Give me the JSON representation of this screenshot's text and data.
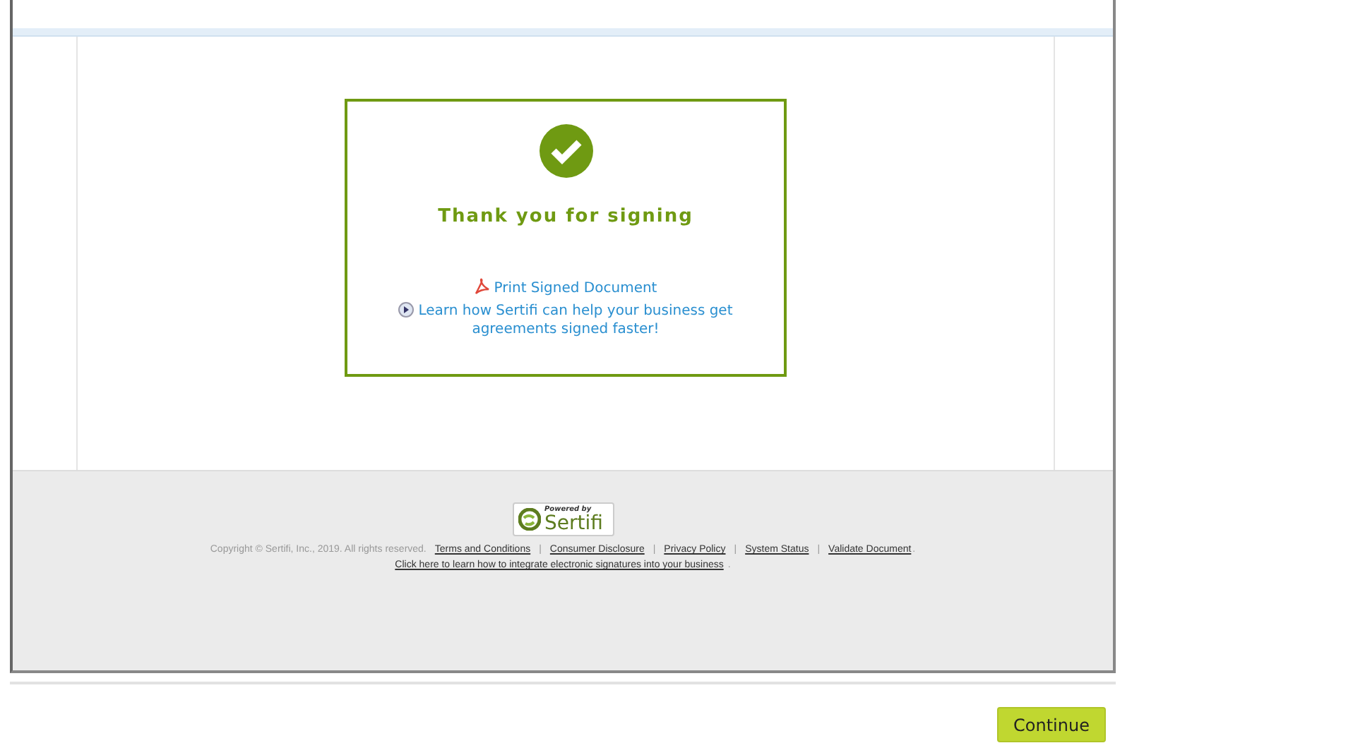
{
  "confirmation": {
    "title": "Thank you for signing",
    "links": [
      {
        "kind": "pdf",
        "label": "Print Signed Document"
      },
      {
        "kind": "play",
        "label": "Learn how Sertifi can help your business get agreements signed faster!"
      }
    ]
  },
  "footer": {
    "logo": {
      "small": "Powered by",
      "name": "Sertifi"
    },
    "copyright": "Copyright © Sertifi, Inc., 2019. All rights reserved.",
    "separator": "|",
    "links": [
      "Terms and Conditions",
      "Consumer Disclosure",
      "Privacy Policy",
      "System Status",
      "Validate Document"
    ],
    "end": ".",
    "integrate_link": "Click here to learn how to integrate electronic signatures into your business",
    "integrate_end": "."
  },
  "continue_button": "Continue"
}
